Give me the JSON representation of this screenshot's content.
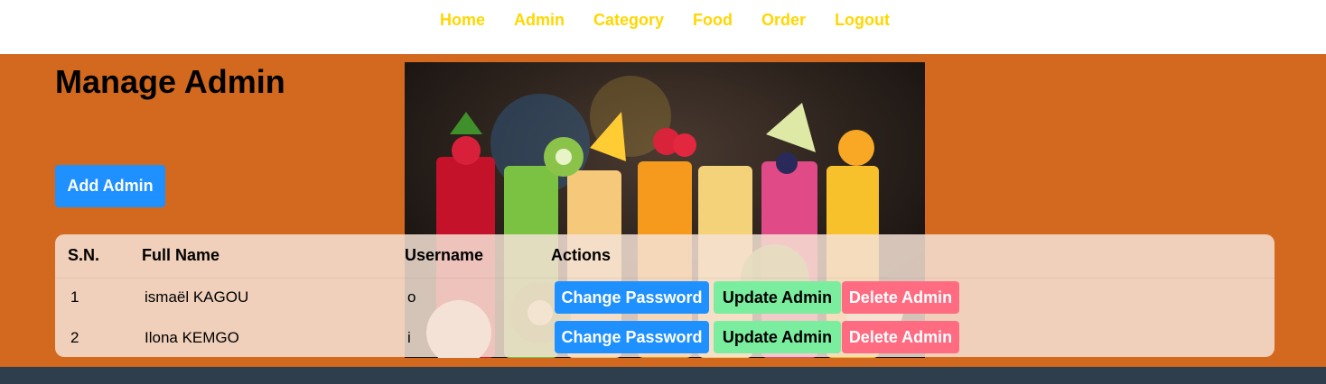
{
  "nav": {
    "links": [
      "Home",
      "Admin",
      "Category",
      "Food",
      "Order",
      "Logout"
    ]
  },
  "page": {
    "title": "Manage Admin",
    "add_button": "Add Admin"
  },
  "image": {
    "subject": "fruit smoothie glasses"
  },
  "table": {
    "headers": [
      "S.N.",
      "Full Name",
      "Username",
      "Actions"
    ],
    "rows": [
      {
        "sn": "1",
        "full_name": "ismaël KAGOU",
        "username": "o"
      },
      {
        "sn": "2",
        "full_name": "Ilona KEMGO",
        "username": "i"
      }
    ],
    "actions": {
      "change_password": "Change Password",
      "update": "Update Admin",
      "delete": "Delete Admin"
    }
  },
  "colors": {
    "nav_link": "#ffd700",
    "main_bg": "#d2691e",
    "footer_bg": "#2f3e4c",
    "primary": "#1e90ff",
    "update": "#7bed9f",
    "delete": "#ff6b81"
  }
}
